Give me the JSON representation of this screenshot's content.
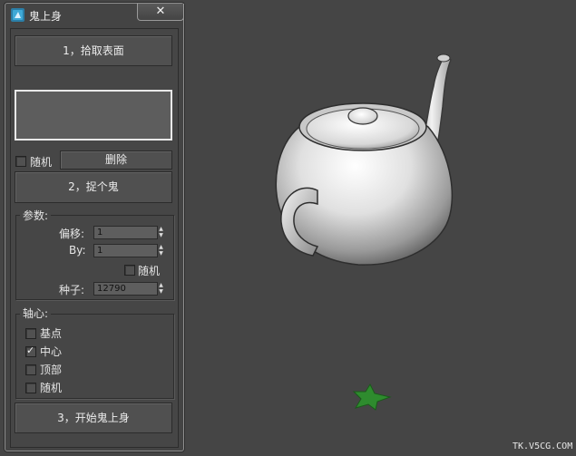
{
  "window": {
    "title": "鬼上身",
    "close_label": "✕"
  },
  "buttons": {
    "pick_surface": "1，拾取表面",
    "delete": "删除",
    "capture_ghost": "2，捉个鬼",
    "start": "3，开始鬼上身"
  },
  "random_top": {
    "label": "随机",
    "checked": false
  },
  "params": {
    "title": "参数:",
    "offset_label": "偏移:",
    "offset_value": "1",
    "by_label": "By:",
    "by_value": "1",
    "random_label": "随机",
    "random_checked": false,
    "seed_label": "种子:",
    "seed_value": "12790"
  },
  "pivot": {
    "title": "轴心:",
    "options": [
      {
        "label": "基点",
        "checked": false
      },
      {
        "label": "中心",
        "checked": true
      },
      {
        "label": "顶部",
        "checked": false
      },
      {
        "label": "随机",
        "checked": false
      }
    ]
  },
  "viewport": {
    "background": "#454545",
    "watermark": "TK.V5CG.COM",
    "star_color": "#2e8b2e"
  }
}
